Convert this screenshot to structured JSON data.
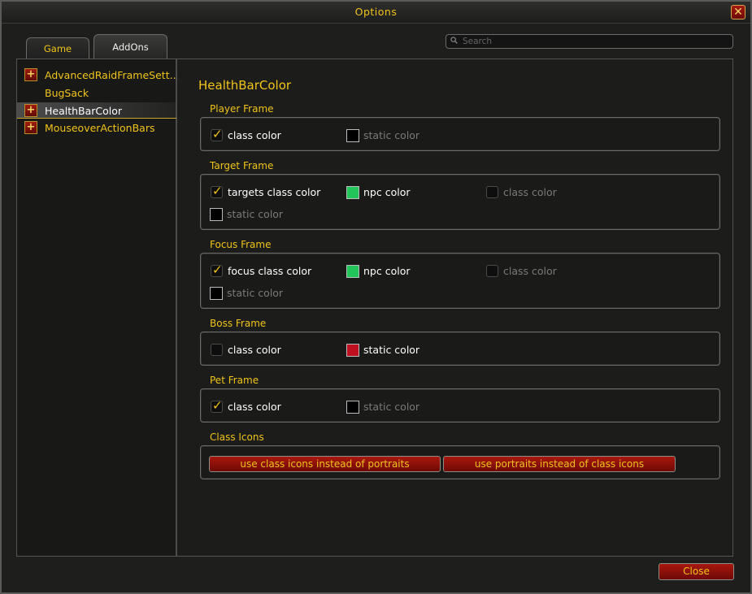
{
  "window": {
    "title": "Options",
    "close_icon": "close-x-icon"
  },
  "tabs": [
    {
      "label": "Game"
    },
    {
      "label": "AddOns"
    }
  ],
  "search": {
    "placeholder": "Search"
  },
  "sidebar": {
    "items": [
      {
        "label": "AdvancedRaidFrameSett...",
        "expandable": true
      },
      {
        "label": "BugSack",
        "expandable": false
      },
      {
        "label": "HealthBarColor",
        "expandable": true,
        "selected": true
      },
      {
        "label": "MouseoverActionBars",
        "expandable": true
      }
    ]
  },
  "main": {
    "heading": "HealthBarColor",
    "sections": {
      "player": {
        "title": "Player Frame",
        "class_color": {
          "label": "class color",
          "checked": true
        },
        "static_color": {
          "label": "static color",
          "swatch": "#000000",
          "disabled": true
        }
      },
      "target": {
        "title": "Target Frame",
        "targets_class_color": {
          "label": "targets class color",
          "checked": true
        },
        "npc_color": {
          "label": "npc color",
          "swatch": "#22c55a"
        },
        "class_color": {
          "label": "class color",
          "disabled": true
        },
        "static_color": {
          "label": "static color",
          "swatch": "#000000",
          "disabled": true
        }
      },
      "focus": {
        "title": "Focus Frame",
        "focus_class_color": {
          "label": "focus class color",
          "checked": true
        },
        "npc_color": {
          "label": "npc color",
          "swatch": "#22c55a"
        },
        "class_color": {
          "label": "class color",
          "disabled": true
        },
        "static_color": {
          "label": "static color",
          "swatch": "#000000",
          "disabled": true
        }
      },
      "boss": {
        "title": "Boss Frame",
        "class_color": {
          "label": "class color",
          "checked": false
        },
        "static_color": {
          "label": "static color",
          "swatch": "#c01020"
        }
      },
      "pet": {
        "title": "Pet Frame",
        "class_color": {
          "label": "class color",
          "checked": true
        },
        "static_color": {
          "label": "static color",
          "swatch": "#000000",
          "disabled": true
        }
      },
      "class_icons": {
        "title": "Class Icons",
        "use_class_icons_label": "use class icons instead of portraits",
        "use_portraits_label": "use portraits instead of class icons"
      }
    }
  },
  "footer": {
    "close_label": "Close"
  },
  "colors": {
    "accent_gold": "#f0c419",
    "button_red": "#8b1008",
    "npc_green": "#22c55a",
    "boss_red": "#c01020"
  }
}
